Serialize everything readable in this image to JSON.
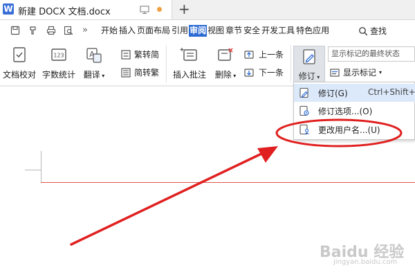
{
  "titlebar": {
    "logo_letter": "W",
    "doc_title": "新建 DOCX 文档.docx",
    "new_tab": "+"
  },
  "tabs": {
    "items": [
      "开始",
      "插入",
      "页面布局",
      "引用",
      "审阅",
      "视图",
      "章节",
      "安全",
      "开发工具",
      "特色应用"
    ],
    "active": "审阅",
    "search_label": "查找",
    "more": "»"
  },
  "ribbon": {
    "proofread": "文档校对",
    "word_count": "字数统计",
    "translate": "翻译",
    "trad_to_simp": "繁转简",
    "simp_to_trad": "简转繁",
    "insert_comment": "插入批注",
    "delete": "删除",
    "prev_item": "上一条",
    "next_item": "下一条",
    "revise": "修订",
    "display_mode": "显示标记的最终状态",
    "show_markup": "显示标记",
    "word_count_digits": "123",
    "translate_glyph": "A"
  },
  "dropdown": {
    "items": [
      {
        "label": "修订(G)",
        "shortcut": "Ctrl+Shift+E"
      },
      {
        "label": "修订选项...(O)",
        "shortcut": ""
      },
      {
        "label": "更改用户名...(U)",
        "shortcut": ""
      }
    ]
  },
  "watermark": {
    "text": "Baidu 经验",
    "url": "jingyan.baidu.com"
  },
  "colors": {
    "accent": "#2d6bd3",
    "annotation": "#e02020",
    "highlight": "#dbe9fb"
  }
}
